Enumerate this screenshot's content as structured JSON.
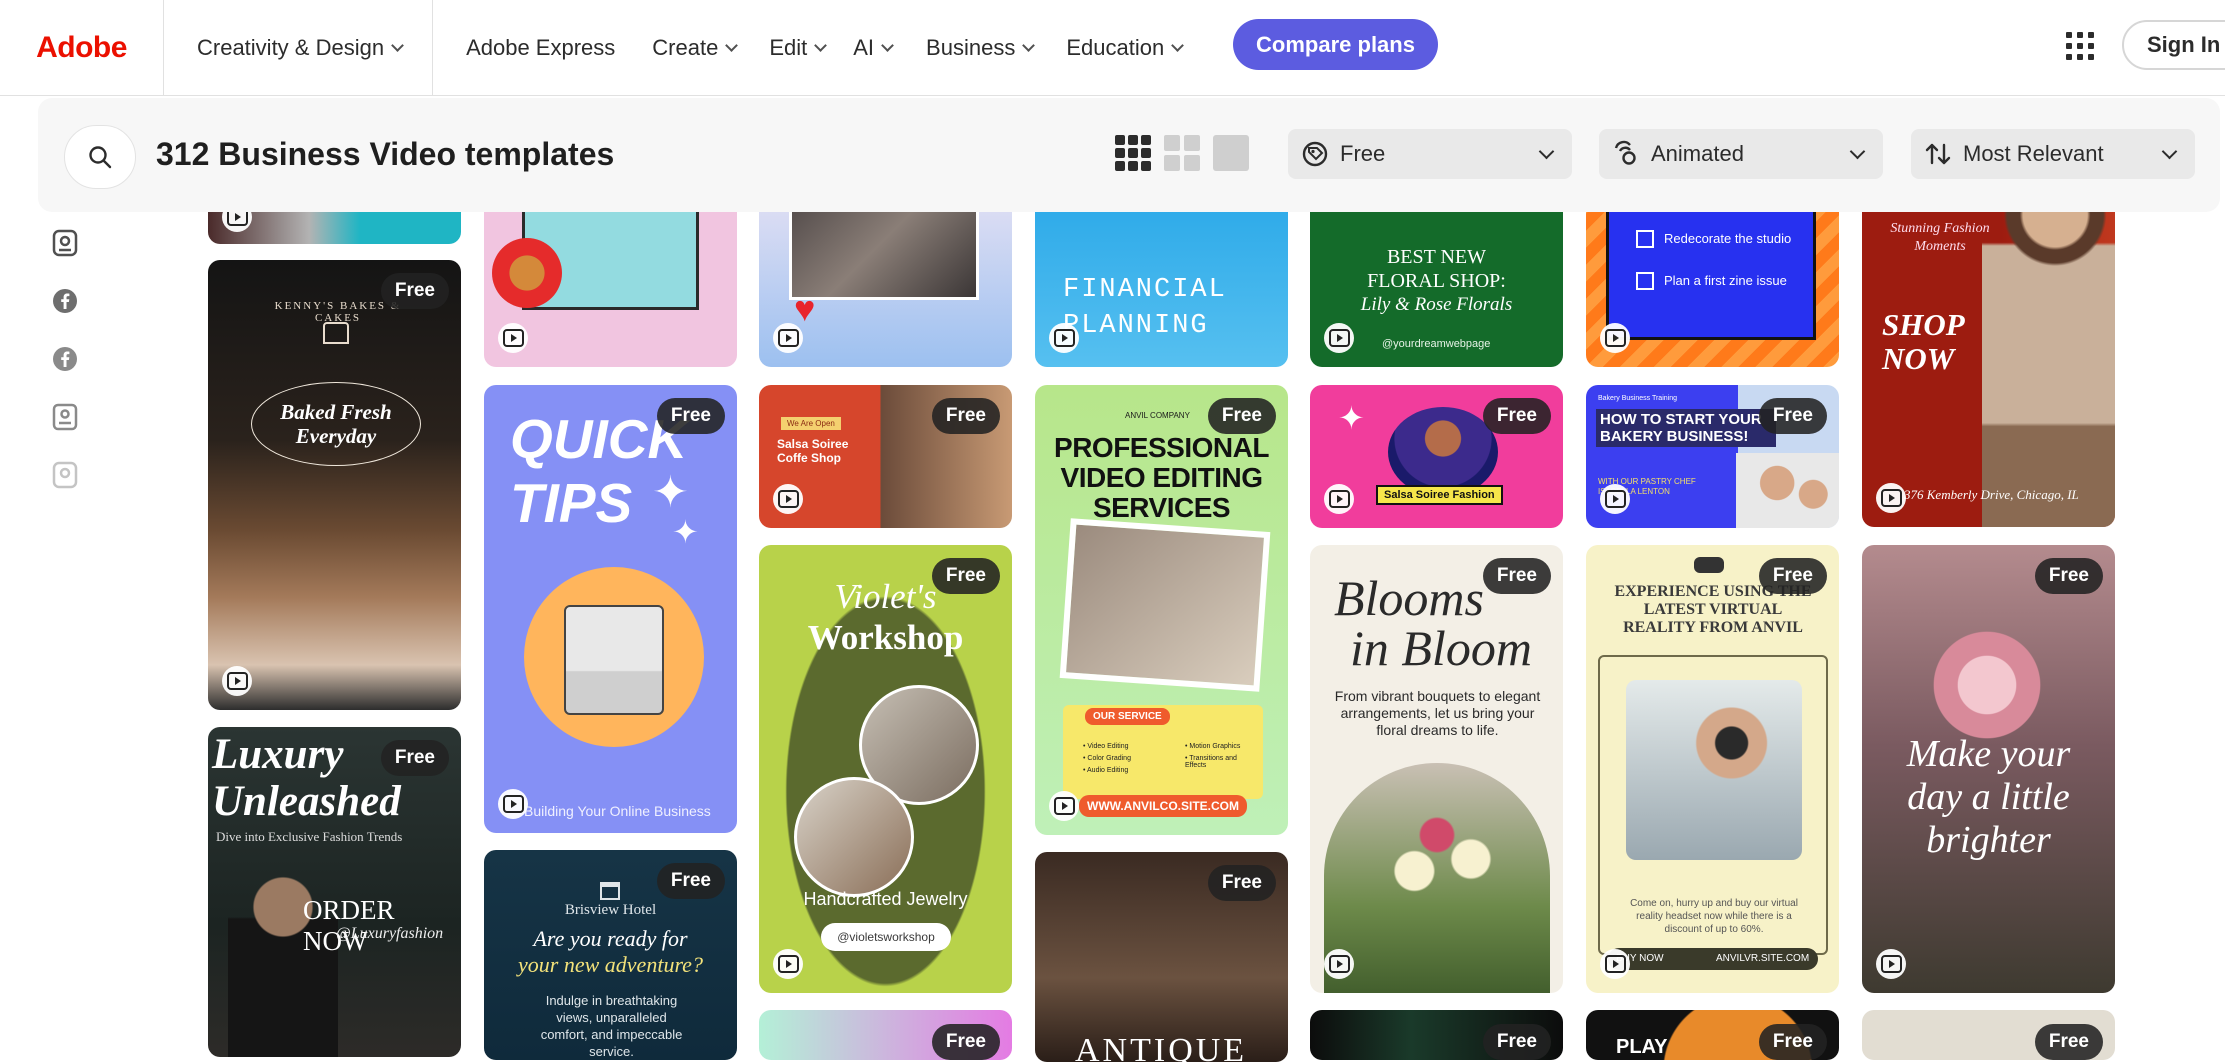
{
  "nav": {
    "logo": "Adobe",
    "creativity": "Creativity & Design",
    "express": "Adobe Express",
    "create": "Create",
    "edit": "Edit",
    "ai": "AI",
    "business": "Business",
    "education": "Education",
    "compare": "Compare plans",
    "signin": "Sign In"
  },
  "search": {
    "title": "312 Business Video templates"
  },
  "filters": {
    "price": "Free",
    "type": "Animated",
    "sort": "Most Relevant"
  },
  "badge_label": "Free",
  "cards": {
    "bakery_brand": "KENNY'S BAKES & CAKES",
    "bakery_headline": "Baked Fresh Everyday",
    "luxury_title": "Luxury Unleashed",
    "luxury_sub": "Dive into Exclusive Fashion Trends",
    "luxury_cta": "ORDER NOW",
    "luxury_handle": "@Luxuryfashion",
    "quick_tips": "QUICK TIPS",
    "quick_tips_footer": "Building Your Online Business",
    "hotel_name": "Brisview Hotel",
    "hotel_headline_1": "Are you ready for",
    "hotel_headline_2": "your new adventure?",
    "hotel_body": "Indulge in breathtaking views, unparalleled comfort, and impeccable service.",
    "coffee_tag": "We Are Open",
    "coffee_name": "Salsa Soiree Coffe Shop",
    "violet_title_1": "Violet's",
    "violet_title_2": "Workshop",
    "violet_sub": "Handcrafted Jewelry",
    "violet_handle": "@violetsworkshop",
    "financial": "FINANCIAL PLANNING",
    "anvil_company": "ANVIL COMPANY",
    "pro_video": "PROFESSIONAL VIDEO EDITING SERVICES",
    "our_service": "OUR SERVICE",
    "service_1": "• Video Editing",
    "service_2": "• Color Grading",
    "service_3": "• Audio Editing",
    "service_4": "• Motion Graphics",
    "service_5": "• Transitions and Effects",
    "anvil_site": "WWW.ANVILCO.SITE.COM",
    "floral_1": "BEST NEW",
    "floral_2": "FLORAL SHOP:",
    "floral_3": "Lily & Rose Florals",
    "floral_handle": "@yourdreamwebpage",
    "salsa_fashion": "Salsa Soiree Fashion",
    "blooms_1": "Blooms",
    "blooms_2": "in Bloom",
    "blooms_body": "From vibrant bouquets to elegant arrangements, let us bring your floral dreams to life.",
    "studio_1": "Redecorate the studio",
    "studio_2": "Plan a first zine issue",
    "bakery_business": "Bakery Business Training",
    "bakery_how": "HOW TO START YOUR BAKERY BUSINESS!",
    "bakery_chef": "WITH OUR PASTRY CHEF ISABELLA LENTON",
    "vr_title": "EXPERIENCE USING THE LATEST VIRTUAL REALITY FROM ANVIL",
    "vr_body": "Come on, hurry up and buy our virtual reality headset now while there is a discount of up to 60%.",
    "vr_buy": "BUY NOW",
    "vr_site": "ANVILVR.SITE.COM",
    "shop_sub": "Stunning Fashion Moments",
    "shop_now": "SHOP NOW",
    "shop_address": "376 Kemberly Drive, Chicago, IL",
    "day_brighter": "Make your day a little brighter",
    "antique": "ANTIQUE",
    "play": "PLAY"
  },
  "colors": {
    "brand_red": "#eb1000",
    "accent": "#5c5ce0"
  }
}
